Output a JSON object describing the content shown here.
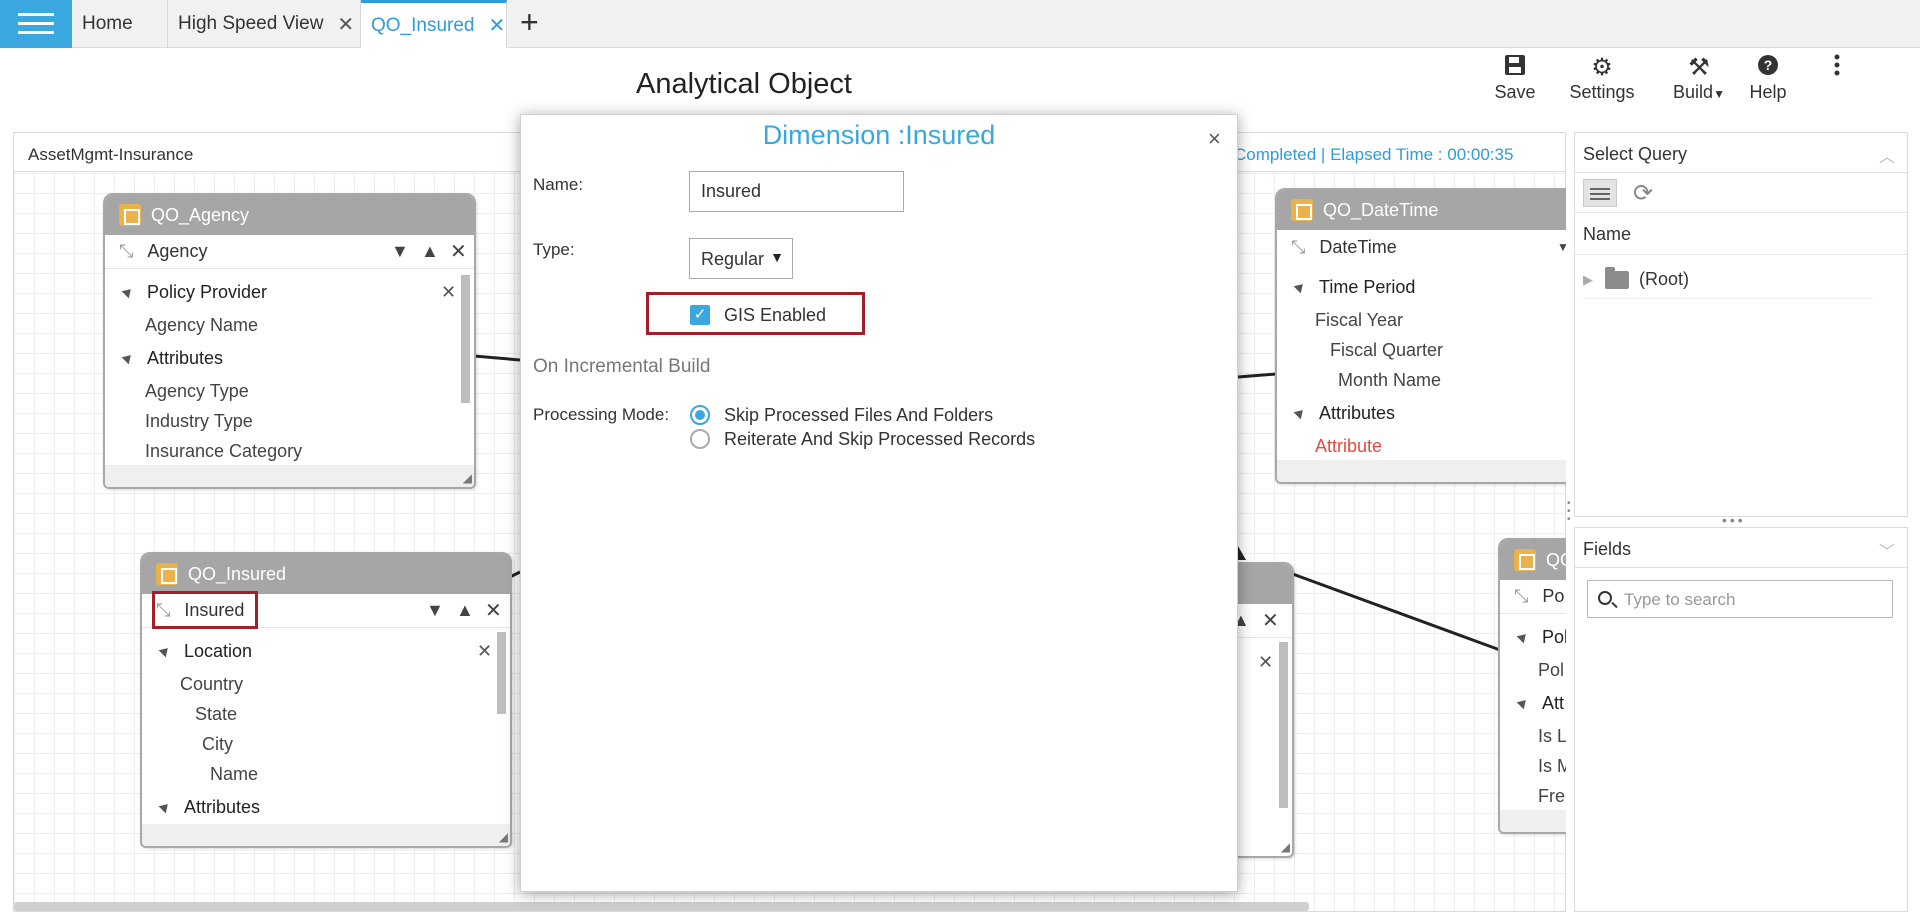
{
  "tabs": [
    {
      "label": "Home"
    },
    {
      "label": "High Speed View",
      "close": "✕"
    },
    {
      "label": "QO_Insured",
      "close": "✕"
    }
  ],
  "add_tab": "+",
  "page_title": "Analytical Object",
  "toolbar": {
    "save": "Save",
    "settings": "Settings",
    "build": "Build",
    "help": "Help"
  },
  "canvas": {
    "model_name": "AssetMgmt-Insurance",
    "status": "Completed | Elapsed Time : 00:00:35"
  },
  "cards": {
    "agency": {
      "title": "QO_Agency",
      "dimension": "Agency",
      "rows": [
        "Policy Provider",
        "Agency Name",
        "Attributes",
        "Agency Type",
        "Industry Type",
        "Insurance Category"
      ]
    },
    "insured": {
      "title": "QO_Insured",
      "dimension": "Insured",
      "rows": [
        "Location",
        "Country",
        "State",
        "City",
        "Name",
        "Attributes"
      ]
    },
    "datetime": {
      "title": "QO_DateTime",
      "dimension": "DateTime",
      "rows": [
        "Time Period",
        "Fiscal Year",
        "Fiscal Quarter",
        "Month Name",
        "Attributes",
        "Attribute"
      ]
    },
    "policy": {
      "title": "QO",
      "dimension": "Po",
      "rows": [
        "Pol",
        "Pol",
        "Att",
        "Is L",
        "Is M",
        "Fre"
      ]
    }
  },
  "right_panel": {
    "query_title": "Select Query",
    "column_name": "Name",
    "root": "(Root)",
    "fields_title": "Fields",
    "search_placeholder": "Type to search"
  },
  "modal": {
    "title": "Dimension :Insured",
    "name_label": "Name:",
    "name_value": "Insured",
    "type_label": "Type:",
    "type_value": "Regular",
    "gis_label": "GIS Enabled",
    "gis_checked": true,
    "incremental_label": "On Incremental Build",
    "processing_label": "Processing Mode:",
    "options": [
      "Skip Processed Files And Folders",
      "Reiterate And Skip Processed Records"
    ],
    "selected_option": 0
  },
  "colors": {
    "accent": "#3aa7de",
    "highlight": "#a31f2a",
    "card_header": "#a6a6a6",
    "attribute_red": "#e04b3f"
  }
}
